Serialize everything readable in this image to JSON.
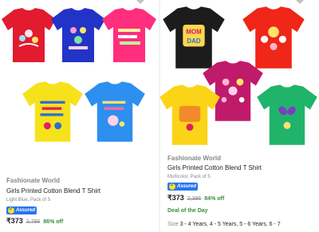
{
  "products": [
    {
      "brand": "Fashionate World",
      "title": "Girls Printed Cotton Blend T Shirt",
      "variant": "Light Blue, Pack of 5",
      "assured_label": "Assured",
      "price": "₹373",
      "mrp": "2,796",
      "discount": "86% off",
      "tee_colors": [
        "#e31b2e",
        "#2233c8",
        "#ff2e7e",
        "#f6e21a",
        "#2d8ff0"
      ],
      "tee_prints": [
        "floral",
        "floral",
        "text",
        "text",
        "text"
      ]
    },
    {
      "brand": "Fashionate World",
      "title": "Girls Printed Cotton Blend T Shirt",
      "variant": "Multicolor, Pack of 5",
      "assured_label": "Assured",
      "price": "₹373",
      "mrp": "2,396",
      "discount": "84% off",
      "deal_label": "Deal of the Day",
      "sizes_label": "Size",
      "sizes": "3 - 4 Years, 4 - 5 Years, 5 - 6 Years, 6 - 7",
      "tee_print_text": "MOM DAD",
      "tee_colors": [
        "#1c1c1c",
        "#f02618",
        "#c01a6a",
        "#fbd418",
        "#1fb46a"
      ]
    }
  ],
  "icons": {
    "wishlist": "heart-icon",
    "assured": "assured-badge-icon"
  },
  "colors": {
    "accent": "#2874f0",
    "discount": "#388e3c",
    "text": "#212121",
    "muted": "#878787"
  }
}
